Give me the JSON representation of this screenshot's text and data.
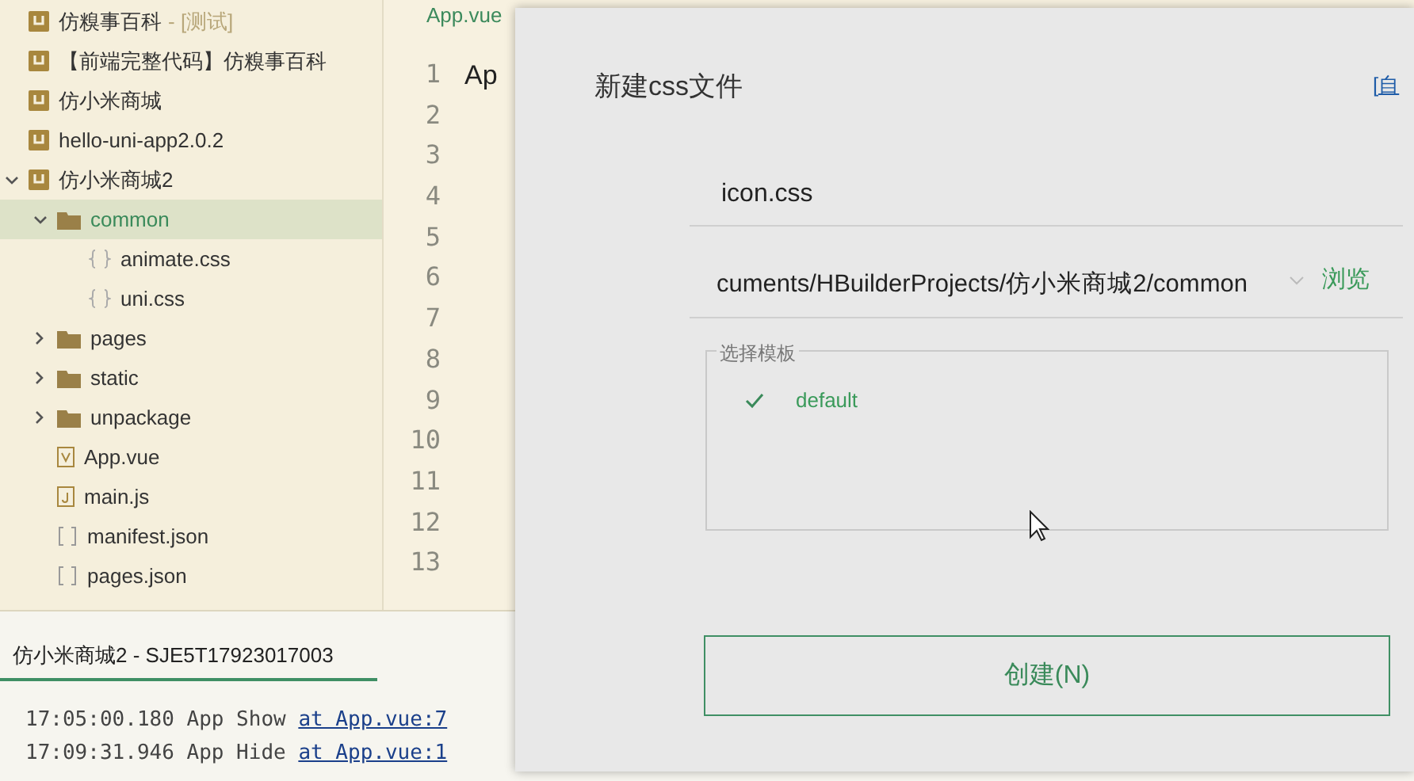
{
  "project_tree": [
    {
      "kind": "project",
      "label": "仿糗事百科",
      "tag": "- [测试]",
      "expanded": false,
      "selected": false
    },
    {
      "kind": "project",
      "label": "【前端完整代码】仿糗事百科",
      "expanded": false,
      "selected": false
    },
    {
      "kind": "project",
      "label": "仿小米商城",
      "expanded": false,
      "selected": false
    },
    {
      "kind": "project",
      "label": "hello-uni-app2.0.2",
      "expanded": false,
      "selected": false
    },
    {
      "kind": "project",
      "label": "仿小米商城2",
      "expanded": true,
      "selected": false,
      "children": [
        {
          "kind": "folder",
          "label": "common",
          "expanded": true,
          "selected": true,
          "children": [
            {
              "kind": "css",
              "label": "animate.css",
              "selected": false
            },
            {
              "kind": "css",
              "label": "uni.css",
              "selected": false
            }
          ]
        },
        {
          "kind": "folder",
          "label": "pages",
          "expanded": false,
          "selected": false
        },
        {
          "kind": "folder",
          "label": "static",
          "expanded": false,
          "selected": false
        },
        {
          "kind": "folder",
          "label": "unpackage",
          "expanded": false,
          "selected": false
        },
        {
          "kind": "vue",
          "label": "App.vue",
          "selected": false
        },
        {
          "kind": "js",
          "label": "main.js",
          "selected": false
        },
        {
          "kind": "json",
          "label": "manifest.json",
          "selected": false
        },
        {
          "kind": "json",
          "label": "pages.json",
          "selected": false
        }
      ]
    }
  ],
  "editor": {
    "tab": "App.vue",
    "line_numbers": [
      "1",
      "2",
      "3",
      "4",
      "5",
      "6",
      "7",
      "8",
      "9",
      "10",
      "11",
      "12",
      "13"
    ],
    "first_line": "Ap"
  },
  "console": {
    "tab": "仿小米商城2 - SJE5T17923017003",
    "lines": [
      {
        "time": "17:05:00.180",
        "message": "App Show",
        "link": "at App.vue:7"
      },
      {
        "time": "17:09:31.946",
        "message": "App Hide",
        "link": "at App.vue:1"
      }
    ]
  },
  "dialog": {
    "title": "新建css文件",
    "corner_link": "[自",
    "file_name": "icon.css",
    "path": "cuments/HBuilderProjects/仿小米商城2/common",
    "browse": "浏览",
    "template_legend": "选择模板",
    "templates": [
      {
        "label": "default",
        "selected": true
      }
    ],
    "create_button": "创建(N)"
  }
}
